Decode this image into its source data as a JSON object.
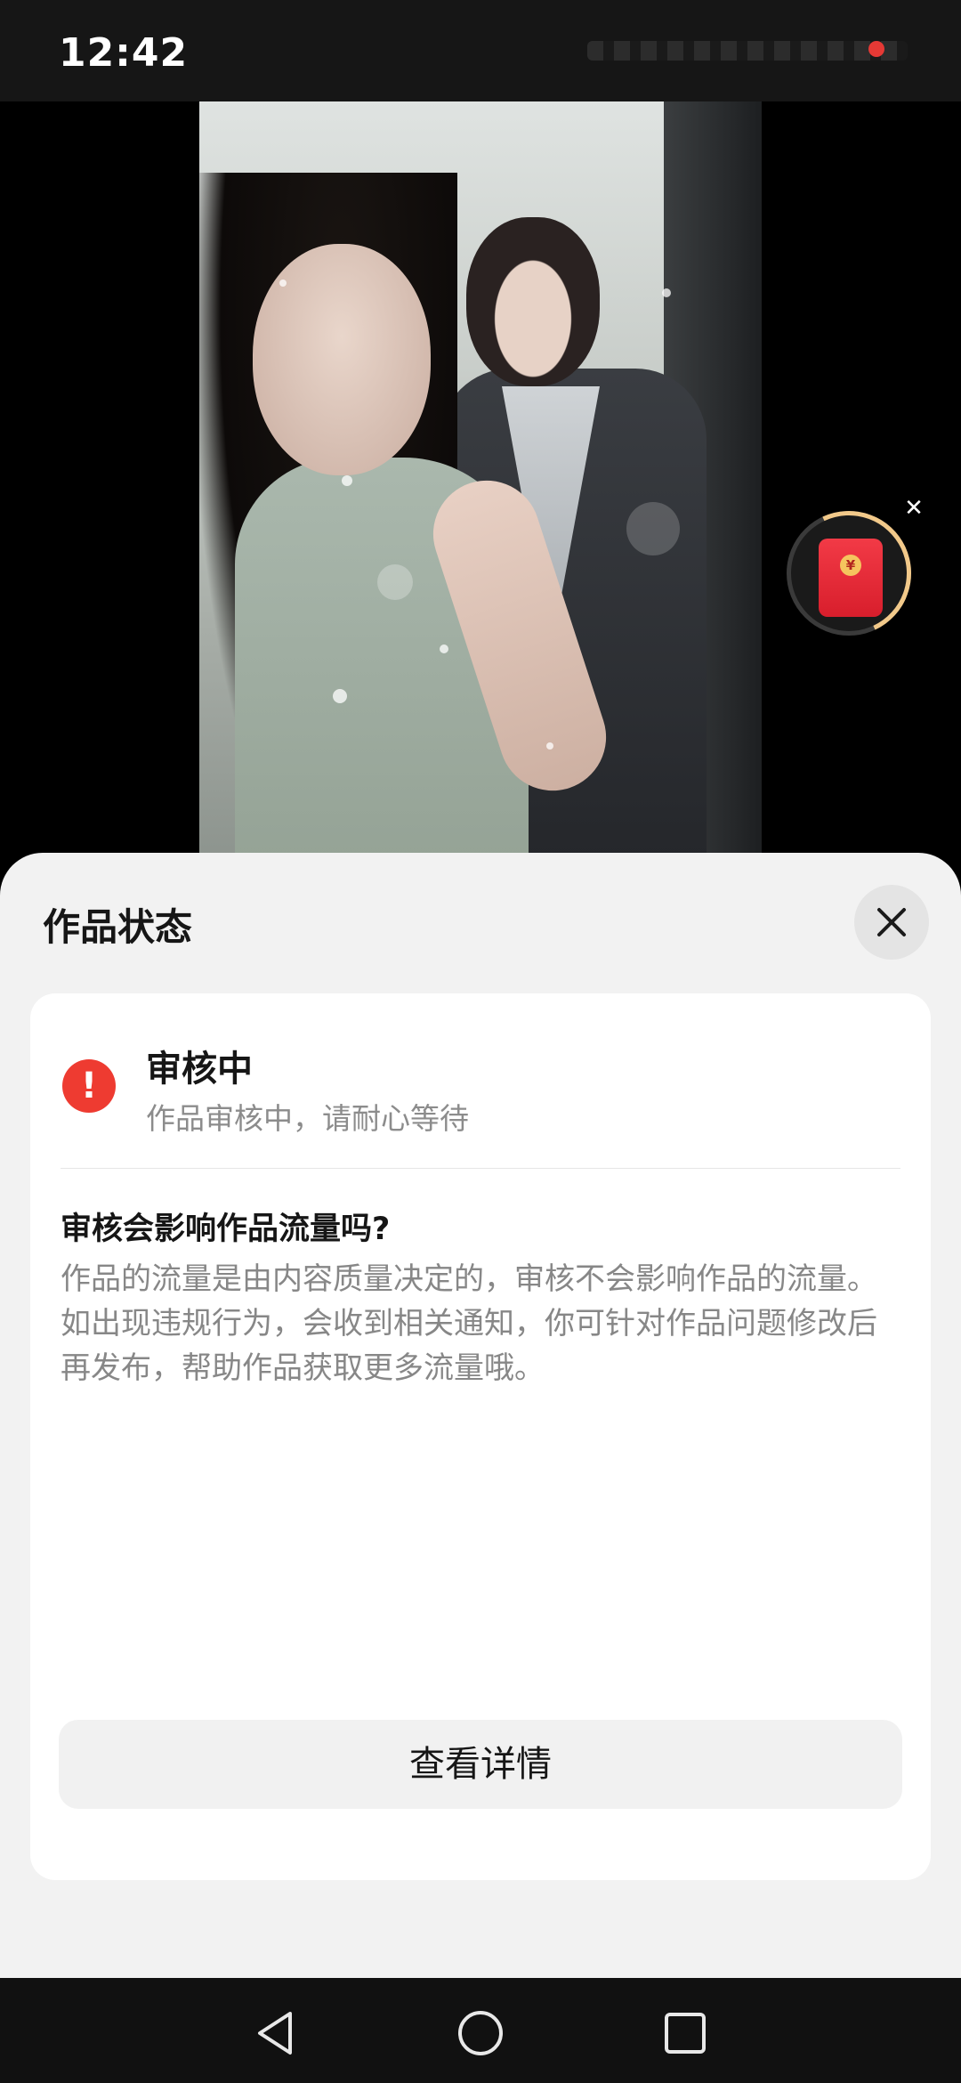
{
  "status_bar": {
    "time": "12:42"
  },
  "colors": {
    "accent_red": "#ee3b31",
    "sheet_bg": "#f2f2f2",
    "card_bg": "#ffffff",
    "red_packet": "#e8313f",
    "ring_gold": "#f2c98a",
    "notification_dot": "#e53935"
  },
  "red_packet": {
    "icon": "red-packet-icon",
    "coin_symbol": "¥",
    "close_icon": "close-icon"
  },
  "sheet": {
    "title": "作品状态",
    "close_icon": "close-icon",
    "status": {
      "icon": "exclamation-icon",
      "title": "审核中",
      "description": "作品审核中，请耐心等待"
    },
    "faq": {
      "question": "审核会影响作品流量吗?",
      "answer": "作品的流量是由内容质量决定的，审核不会影响作品的流量。如出现违规行为，会收到相关通知，你可针对作品问题修改后再发布，帮助作品获取更多流量哦。"
    },
    "detail_button": "查看详情"
  },
  "nav_bar": {
    "icons": [
      "back-triangle-icon",
      "home-circle-icon",
      "recents-square-icon"
    ]
  }
}
